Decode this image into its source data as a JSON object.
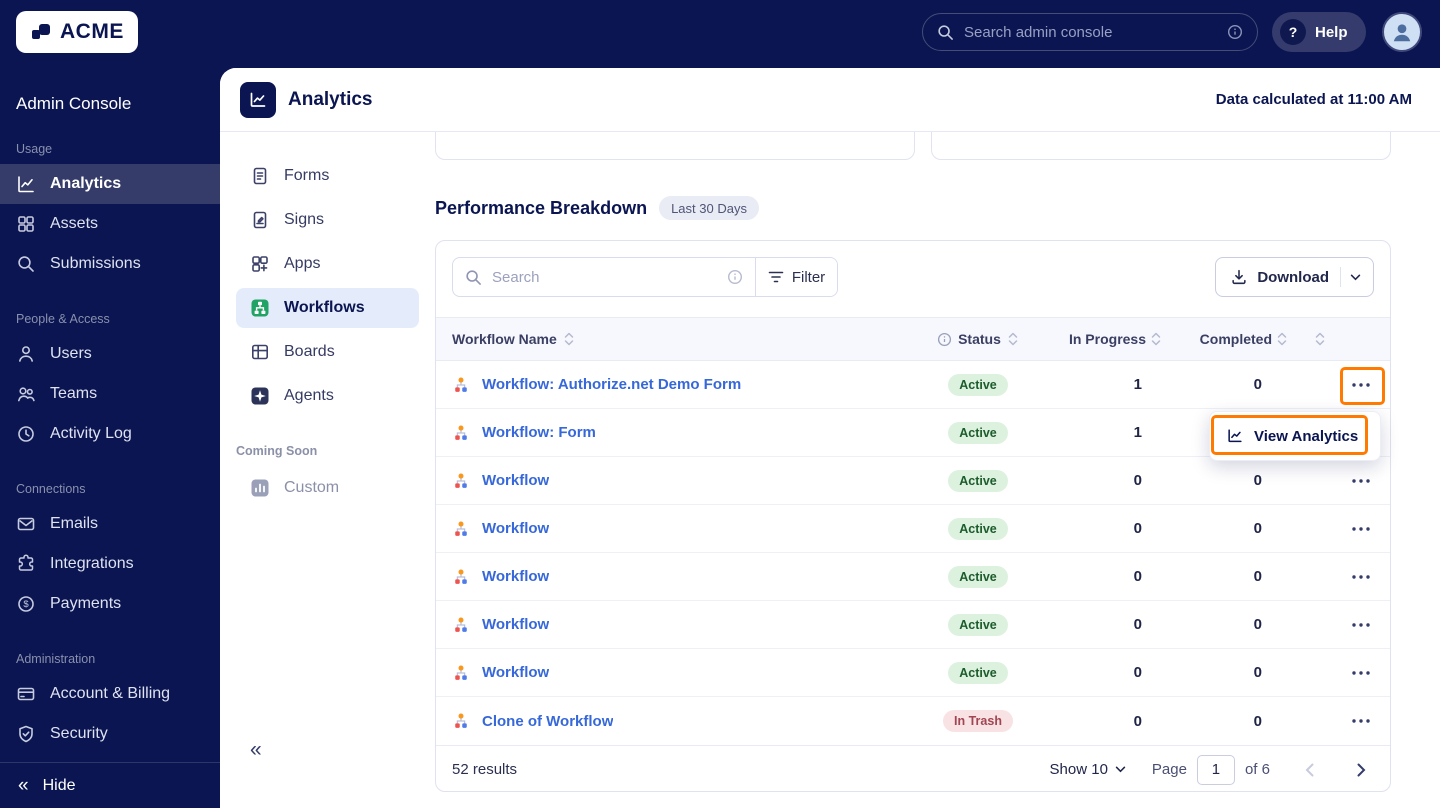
{
  "topbar": {
    "brand": "ACME",
    "search": {
      "placeholder": "Search admin console"
    },
    "help_label": "Help"
  },
  "sidebar": {
    "title": "Admin Console",
    "sections": [
      {
        "label": "Usage",
        "items": [
          {
            "label": "Analytics",
            "icon": "chart-line-icon"
          },
          {
            "label": "Assets",
            "icon": "assets-grid-icon"
          },
          {
            "label": "Submissions",
            "icon": "search-icon"
          }
        ]
      },
      {
        "label": "People & Access",
        "items": [
          {
            "label": "Users",
            "icon": "user-icon"
          },
          {
            "label": "Teams",
            "icon": "users-icon"
          },
          {
            "label": "Activity Log",
            "icon": "history-clock-icon"
          }
        ]
      },
      {
        "label": "Connections",
        "items": [
          {
            "label": "Emails",
            "icon": "envelope-icon"
          },
          {
            "label": "Integrations",
            "icon": "puzzle-icon"
          },
          {
            "label": "Payments",
            "icon": "dollar-circle-icon"
          }
        ]
      },
      {
        "label": "Administration",
        "items": [
          {
            "label": "Account & Billing",
            "icon": "credit-card-icon"
          },
          {
            "label": "Security",
            "icon": "shield-icon"
          }
        ]
      }
    ],
    "hide_label": "Hide"
  },
  "page": {
    "title": "Analytics",
    "data_calculated": "Data calculated at 11:00 AM"
  },
  "subnav": {
    "items": [
      {
        "label": "Forms",
        "icon": "forms-doc-icon"
      },
      {
        "label": "Signs",
        "icon": "signs-doc-icon"
      },
      {
        "label": "Apps",
        "icon": "apps-grid-icon"
      },
      {
        "label": "Workflows",
        "icon": "workflows-icon",
        "active": true
      },
      {
        "label": "Boards",
        "icon": "boards-icon"
      },
      {
        "label": "Agents",
        "icon": "agents-sparkle-icon"
      }
    ],
    "coming_soon": {
      "label": "Coming Soon",
      "items": [
        {
          "label": "Custom",
          "icon": "custom-icon"
        }
      ]
    }
  },
  "performance": {
    "title": "Performance Breakdown",
    "badge": "Last 30 Days",
    "toolbar": {
      "search_placeholder": "Search",
      "filter_label": "Filter",
      "download_label": "Download"
    },
    "table": {
      "columns": {
        "name": "Workflow Name",
        "status": "Status",
        "in_progress": "In Progress",
        "completed": "Completed"
      },
      "rows": [
        {
          "name": "Workflow: Authorize.net Demo Form",
          "status": "Active",
          "in_progress": "1",
          "completed": "0"
        },
        {
          "name": "Workflow: Form",
          "status": "Active",
          "in_progress": "1",
          "completed": ""
        },
        {
          "name": "Workflow",
          "status": "Active",
          "in_progress": "0",
          "completed": "0"
        },
        {
          "name": "Workflow",
          "status": "Active",
          "in_progress": "0",
          "completed": "0"
        },
        {
          "name": "Workflow",
          "status": "Active",
          "in_progress": "0",
          "completed": "0"
        },
        {
          "name": "Workflow",
          "status": "Active",
          "in_progress": "0",
          "completed": "0"
        },
        {
          "name": "Workflow",
          "status": "Active",
          "in_progress": "0",
          "completed": "0"
        },
        {
          "name": "Clone of Workflow",
          "status": "In Trash",
          "in_progress": "0",
          "completed": "0"
        }
      ]
    },
    "menu": {
      "view_analytics_label": "View Analytics"
    },
    "footer": {
      "results": "52 results",
      "show_label": "Show 10",
      "page_label": "Page",
      "page_value": "1",
      "of_label": "of 6"
    }
  },
  "colors": {
    "navy": "#0a1551",
    "sidebar_active": "#353c69",
    "accent_orange": "#ff7a00",
    "link_blue": "#3668d9",
    "green_badge_bg": "#dcf1de",
    "green_badge_text": "#1d5c2c",
    "red_badge_bg": "#f9e2e4",
    "red_badge_text": "#a04653",
    "workflows_green": "#21a366"
  }
}
